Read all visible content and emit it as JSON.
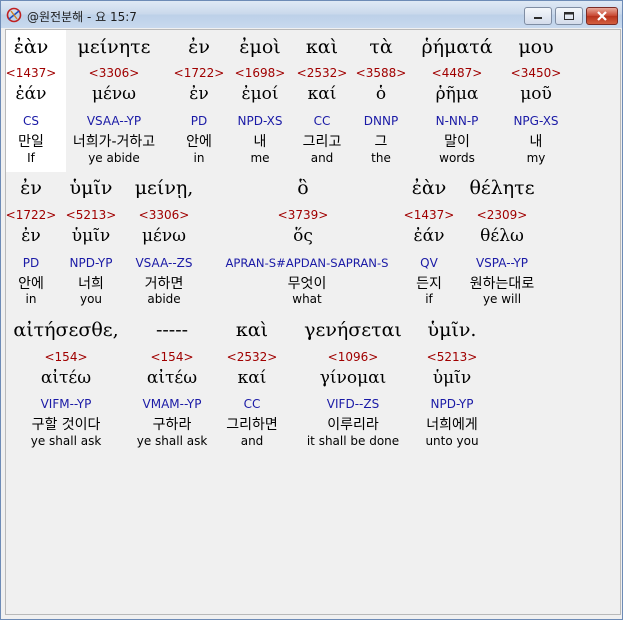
{
  "window": {
    "title": "@원전분해 - 요 15:7",
    "icon": "app-swirl-icon",
    "controls": [
      "minimize-icon",
      "maximize-icon",
      "close-icon"
    ]
  },
  "lines": [
    [
      {
        "greek": "ἐὰν",
        "strong": "<1437>",
        "lemma": "ἐάν",
        "parse": "CS",
        "korean": "만일",
        "english": "If",
        "selected": true
      },
      {
        "greek": "μείνητε",
        "strong": "<3306>",
        "lemma": "μένω",
        "parse": "VSAA--YP",
        "korean": "너희가-거하고",
        "english": "ye abide"
      },
      {
        "greek": "ἐν",
        "strong": "<1722>",
        "lemma": "ἐν",
        "parse": "PD",
        "korean": "안에",
        "english": "in"
      },
      {
        "greek": "ἐμοὶ",
        "strong": "<1698>",
        "lemma": "ἐμοί",
        "parse": "NPD-XS",
        "korean": "내",
        "english": "me"
      },
      {
        "greek": "καὶ",
        "strong": "<2532>",
        "lemma": "καί",
        "parse": "CC",
        "korean": "그리고",
        "english": "and"
      },
      {
        "greek": "τὰ",
        "strong": "<3588>",
        "lemma": "ὁ",
        "parse": "DNNP",
        "korean": "그",
        "english": "the"
      },
      {
        "greek": "ῥήματά",
        "strong": "<4487>",
        "lemma": "ῥῆμα",
        "parse": "N-NN-P",
        "korean": "말이",
        "english": "words"
      },
      {
        "greek": "μου",
        "strong": "<3450>",
        "lemma": "μοῦ",
        "parse": "NPG-XS",
        "korean": "내",
        "english": "my"
      }
    ],
    [
      {
        "greek": "ἐν",
        "strong": "<1722>",
        "lemma": "ἐν",
        "parse": "PD",
        "korean": "안에",
        "english": "in"
      },
      {
        "greek": "ὑμῖν",
        "strong": "<5213>",
        "lemma": "ὑμῖν",
        "parse": "NPD-YP",
        "korean": "너희",
        "english": "you"
      },
      {
        "greek": "μείνῃ,",
        "strong": "<3306>",
        "lemma": "μένω",
        "parse": "VSAA--ZS",
        "korean": "거하면",
        "english": "abide"
      },
      {
        "greek": "ὃ",
        "strong": "<3739>",
        "lemma": "ὅς",
        "parse": "APRAN-S#APDAN-SAPRAN-S",
        "korean": "무엇이",
        "english": "what"
      },
      {
        "greek": "ἐὰν",
        "strong": "<1437>",
        "lemma": "ἐάν",
        "parse": "QV",
        "korean": "든지",
        "english": "if"
      },
      {
        "greek": "θέλητε",
        "strong": "<2309>",
        "lemma": "θέλω",
        "parse": "VSPA--YP",
        "korean": "원하는대로",
        "english": "ye will"
      }
    ],
    [
      {
        "greek": "αἰτήσεσθε,",
        "strong": "<154>",
        "lemma": "αἰτέω",
        "parse": "VIFM--YP",
        "korean": "구할 것이다",
        "english": "ye shall ask"
      },
      {
        "greek": "-----",
        "strong": "<154>",
        "lemma": "αἰτέω",
        "parse": "VMAM--YP",
        "korean": "구하라",
        "english": "ye shall ask"
      },
      {
        "greek": "καὶ",
        "strong": "<2532>",
        "lemma": "καί",
        "parse": "CC",
        "korean": "그리하면",
        "english": "and"
      },
      {
        "greek": "γενήσεται",
        "strong": "<1096>",
        "lemma": "γίνομαι",
        "parse": "VIFD--ZS",
        "korean": "이루리라",
        "english": "it shall be done"
      },
      {
        "greek": "ὑμῖν.",
        "strong": "<5213>",
        "lemma": "ὑμῖν",
        "parse": "NPD-YP",
        "korean": "너희에게",
        "english": "unto you"
      }
    ]
  ],
  "colors": {
    "strong": "#a00000",
    "parse": "#1a1aa6",
    "selected_bg": "#ffffff"
  }
}
